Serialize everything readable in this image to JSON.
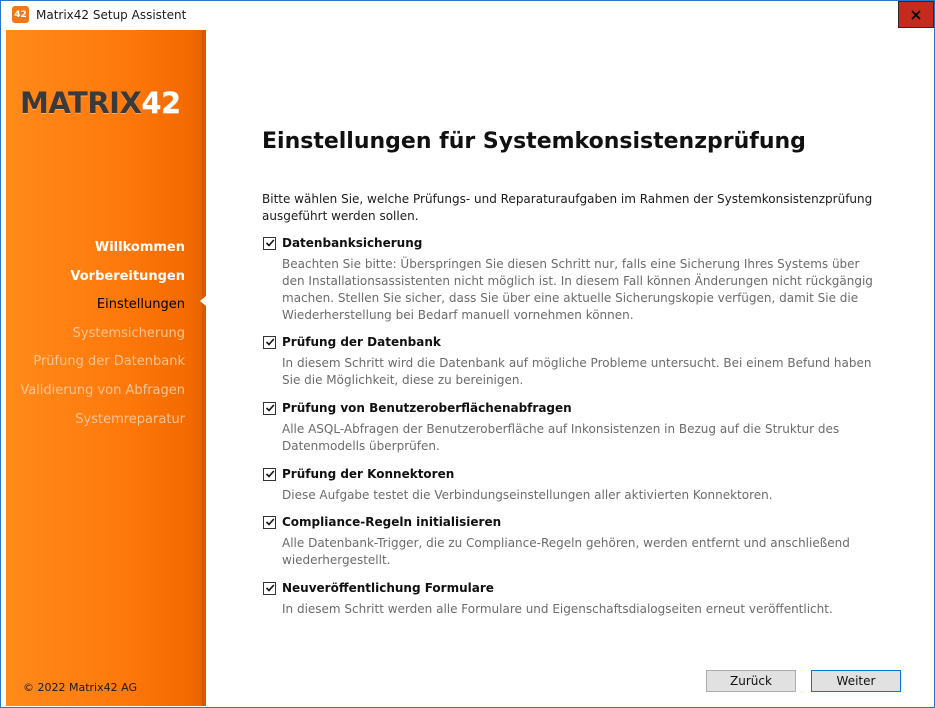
{
  "window": {
    "title": "Matrix42 Setup Assistent",
    "app_icon_text": "42",
    "accent": "#f07818",
    "close_symbol": "×"
  },
  "sidebar": {
    "logo_text": "MATRIX",
    "logo_number": "42",
    "items": [
      {
        "label": "Willkommen",
        "state": "done"
      },
      {
        "label": "Vorbereitungen",
        "state": "done"
      },
      {
        "label": "Einstellungen",
        "state": "active"
      },
      {
        "label": "Systemsicherung",
        "state": "todo"
      },
      {
        "label": "Prüfung der Datenbank",
        "state": "todo"
      },
      {
        "label": "Validierung von Abfragen",
        "state": "todo"
      },
      {
        "label": "Systemreparatur",
        "state": "todo"
      }
    ],
    "copyright": "© 2022 Matrix42 AG"
  },
  "main": {
    "title": "Einstellungen für Systemkonsistenzprüfung",
    "intro": "Bitte wählen Sie, welche Prüfungs- und Reparaturaufgaben im Rahmen der Systemkonsistenzprüfung ausgeführt werden sollen.",
    "options": [
      {
        "label": "Datenbanksicherung",
        "checked": true,
        "description": "Beachten Sie bitte: Überspringen Sie diesen Schritt nur, falls eine Sicherung Ihres Systems über den Installationsassistenten nicht möglich ist. In diesem Fall können Änderungen nicht rückgängig machen. Stellen Sie sicher, dass Sie über eine aktuelle Sicherungskopie verfügen, damit Sie die Wiederherstellung bei Bedarf manuell vornehmen können."
      },
      {
        "label": "Prüfung der Datenbank",
        "checked": true,
        "description": "In diesem Schritt wird die Datenbank auf mögliche Probleme untersucht. Bei einem Befund haben Sie die Möglichkeit, diese zu bereinigen."
      },
      {
        "label": "Prüfung von Benutzeroberflächenabfragen",
        "checked": true,
        "description": "Alle ASQL-Abfragen der Benutzeroberfläche auf Inkonsistenzen in Bezug auf die Struktur des Datenmodells überprüfen."
      },
      {
        "label": "Prüfung der Konnektoren",
        "checked": true,
        "description": "Diese Aufgabe testet die Verbindungseinstellungen aller aktivierten Konnektoren."
      },
      {
        "label": "Compliance-Regeln initialisieren",
        "checked": true,
        "description": "Alle Datenbank-Trigger, die zu Compliance-Regeln gehören, werden entfernt und anschließend wiederhergestellt."
      },
      {
        "label": "Neuveröffentlichung Formulare",
        "checked": true,
        "description": "In diesem Schritt werden alle Formulare und Eigenschaftsdialogseiten erneut veröffentlicht."
      }
    ]
  },
  "footer": {
    "back_label": "Zurück",
    "next_label": "Weiter"
  }
}
